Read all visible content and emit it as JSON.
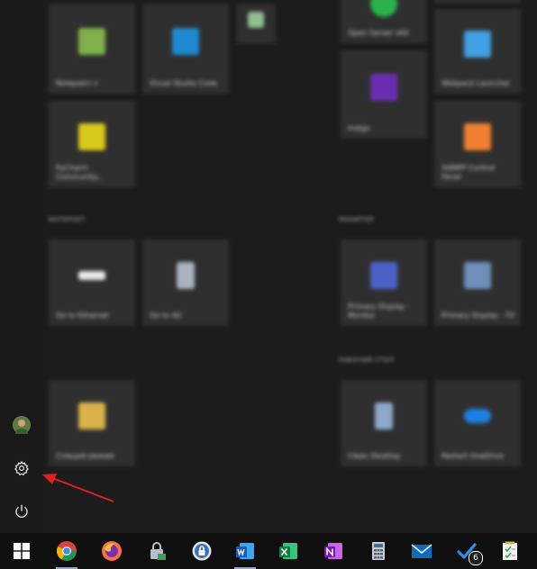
{
  "start_menu": {
    "groups": [
      {
        "label": "ИНТЕРНЕТ"
      },
      {
        "label": "МОНИТОР"
      },
      {
        "label": "РАБОЧИЙ СТОЛ"
      }
    ],
    "tiles": [
      {
        "label": "Notepad++",
        "icon": "notepad-icon"
      },
      {
        "label": "Visual Studio Code",
        "icon": "vscode-icon"
      },
      {
        "label": "",
        "icon": "app-icon"
      },
      {
        "label": "Open Server x64",
        "icon": "open-server-icon"
      },
      {
        "label": "",
        "icon": "app-icon"
      },
      {
        "label": "PyCharm Community...",
        "icon": "pycharm-icon"
      },
      {
        "label": "Indigo",
        "icon": "indigo-icon"
      },
      {
        "label": "Webpack Launcher",
        "icon": "webpack-icon"
      },
      {
        "label": "XAMPP Control Panel",
        "icon": "xampp-icon"
      },
      {
        "label": "Go to Ethernet",
        "icon": "ethernet-icon"
      },
      {
        "label": "Go to 4G",
        "icon": "mobile-icon"
      },
      {
        "label": "Primary Display - Monitor",
        "icon": "display-icon"
      },
      {
        "label": "Primary Display - TV",
        "icon": "tv-icon"
      },
      {
        "label": "Спящий режим",
        "icon": "sleep-icon"
      },
      {
        "label": "Clean Desktop",
        "icon": "clean-desktop-icon"
      },
      {
        "label": "Restart OneDrive",
        "icon": "onedrive-icon"
      }
    ]
  },
  "rail": {
    "items": [
      {
        "name": "user-avatar",
        "icon": "avatar-icon"
      },
      {
        "name": "settings",
        "icon": "gear-icon"
      },
      {
        "name": "power",
        "icon": "power-icon"
      }
    ]
  },
  "annotation": {
    "color": "#e02020",
    "target": "settings"
  },
  "taskbar": {
    "items": [
      {
        "icon": "windows-start-icon"
      },
      {
        "icon": "chrome-icon",
        "active": true
      },
      {
        "icon": "firefox-icon"
      },
      {
        "icon": "vpn-lock-icon"
      },
      {
        "icon": "keepass-icon"
      },
      {
        "icon": "word-icon",
        "active": true
      },
      {
        "icon": "excel-icon"
      },
      {
        "icon": "onenote-icon"
      },
      {
        "icon": "calculator-icon"
      },
      {
        "icon": "mail-icon"
      },
      {
        "icon": "todo-icon",
        "badge": "6"
      },
      {
        "icon": "notes-checklist-icon"
      }
    ]
  },
  "colors": {
    "menu_bg": "#1c1c1c",
    "tile_bg": "#2f2f2f",
    "taskbar_bg": "#0f0f0f"
  }
}
